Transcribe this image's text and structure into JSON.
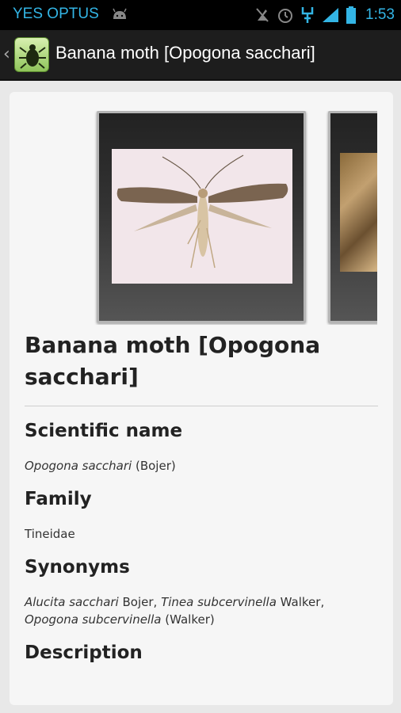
{
  "status": {
    "carrier": "YES OPTUS",
    "time": "1:53",
    "icons": [
      "android-icon",
      "mute-icon",
      "alarm-icon",
      "usb-icon",
      "signal-icon",
      "battery-icon"
    ]
  },
  "action_bar": {
    "title": "Banana moth [Opogona sacchari]",
    "up_caret": "‹"
  },
  "gallery": {
    "images": [
      "moth-specimen-photo",
      "moth-damage-photo"
    ]
  },
  "page": {
    "title": "Banana moth [Opogona sacchari]",
    "sections": [
      {
        "heading": "Scientific name",
        "parts": [
          {
            "text": "Opogona sacchari",
            "italic": true
          },
          {
            "text": " (Bojer)",
            "italic": false
          }
        ]
      },
      {
        "heading": "Family",
        "parts": [
          {
            "text": "Tineidae",
            "italic": false
          }
        ]
      },
      {
        "heading": "Synonyms",
        "parts": [
          {
            "text": "Alucita sacchari",
            "italic": true
          },
          {
            "text": " Bojer, ",
            "italic": false
          },
          {
            "text": "Tinea subcervinella",
            "italic": true
          },
          {
            "text": " Walker, ",
            "italic": false
          },
          {
            "text": "Opogona subcervinella",
            "italic": true
          },
          {
            "text": " (Walker)",
            "italic": false
          }
        ]
      },
      {
        "heading": "Description",
        "parts": []
      }
    ]
  },
  "colors": {
    "status_accent": "#33b5e5",
    "action_bar_bg": "#1d1d1d",
    "card_bg": "#f6f6f6"
  }
}
